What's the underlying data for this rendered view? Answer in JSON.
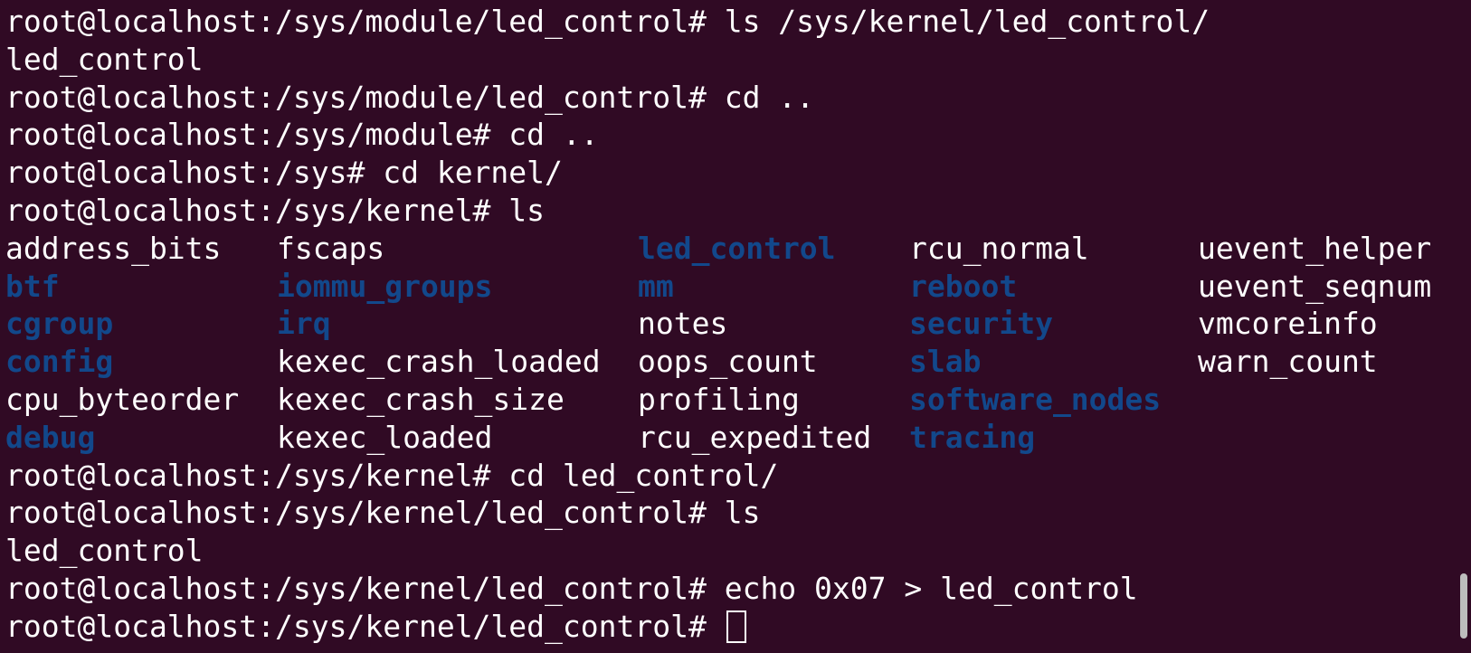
{
  "terminal": {
    "lines_before": [
      "root@localhost:/sys/module/led_control# ls /sys/kernel/led_control/",
      "led_control",
      "root@localhost:/sys/module/led_control# cd ..",
      "root@localhost:/sys/module# cd ..",
      "root@localhost:/sys# cd kernel/",
      "root@localhost:/sys/kernel# ls"
    ],
    "ls_rows": [
      [
        {
          "name": "address_bits",
          "type": "file"
        },
        {
          "name": "fscaps",
          "type": "file"
        },
        {
          "name": "led_control",
          "type": "dir"
        },
        {
          "name": "rcu_normal",
          "type": "file"
        },
        {
          "name": "uevent_helper",
          "type": "file"
        }
      ],
      [
        {
          "name": "btf",
          "type": "dir"
        },
        {
          "name": "iommu_groups",
          "type": "dir"
        },
        {
          "name": "mm",
          "type": "dir"
        },
        {
          "name": "reboot",
          "type": "dir"
        },
        {
          "name": "uevent_seqnum",
          "type": "file"
        }
      ],
      [
        {
          "name": "cgroup",
          "type": "dir"
        },
        {
          "name": "irq",
          "type": "dir"
        },
        {
          "name": "notes",
          "type": "file"
        },
        {
          "name": "security",
          "type": "dir"
        },
        {
          "name": "vmcoreinfo",
          "type": "file"
        }
      ],
      [
        {
          "name": "config",
          "type": "dir"
        },
        {
          "name": "kexec_crash_loaded",
          "type": "file"
        },
        {
          "name": "oops_count",
          "type": "file"
        },
        {
          "name": "slab",
          "type": "dir"
        },
        {
          "name": "warn_count",
          "type": "file"
        }
      ],
      [
        {
          "name": "cpu_byteorder",
          "type": "file"
        },
        {
          "name": "kexec_crash_size",
          "type": "file"
        },
        {
          "name": "profiling",
          "type": "file"
        },
        {
          "name": "software_nodes",
          "type": "dir"
        },
        {
          "name": "",
          "type": "file"
        }
      ],
      [
        {
          "name": "debug",
          "type": "dir"
        },
        {
          "name": "kexec_loaded",
          "type": "file"
        },
        {
          "name": "rcu_expedited",
          "type": "file"
        },
        {
          "name": "tracing",
          "type": "dir"
        },
        {
          "name": "",
          "type": "file"
        }
      ]
    ],
    "lines_after": [
      "root@localhost:/sys/kernel# cd led_control/",
      "root@localhost:/sys/kernel/led_control# ls",
      "led_control",
      "root@localhost:/sys/kernel/led_control# echo 0x07 > led_control"
    ],
    "current_prompt": "root@localhost:/sys/kernel/led_control# ",
    "colors": {
      "background": "#300a24",
      "foreground": "#ffffff",
      "directory": "#12488b",
      "scrollbar": "#bdbdbd"
    }
  }
}
